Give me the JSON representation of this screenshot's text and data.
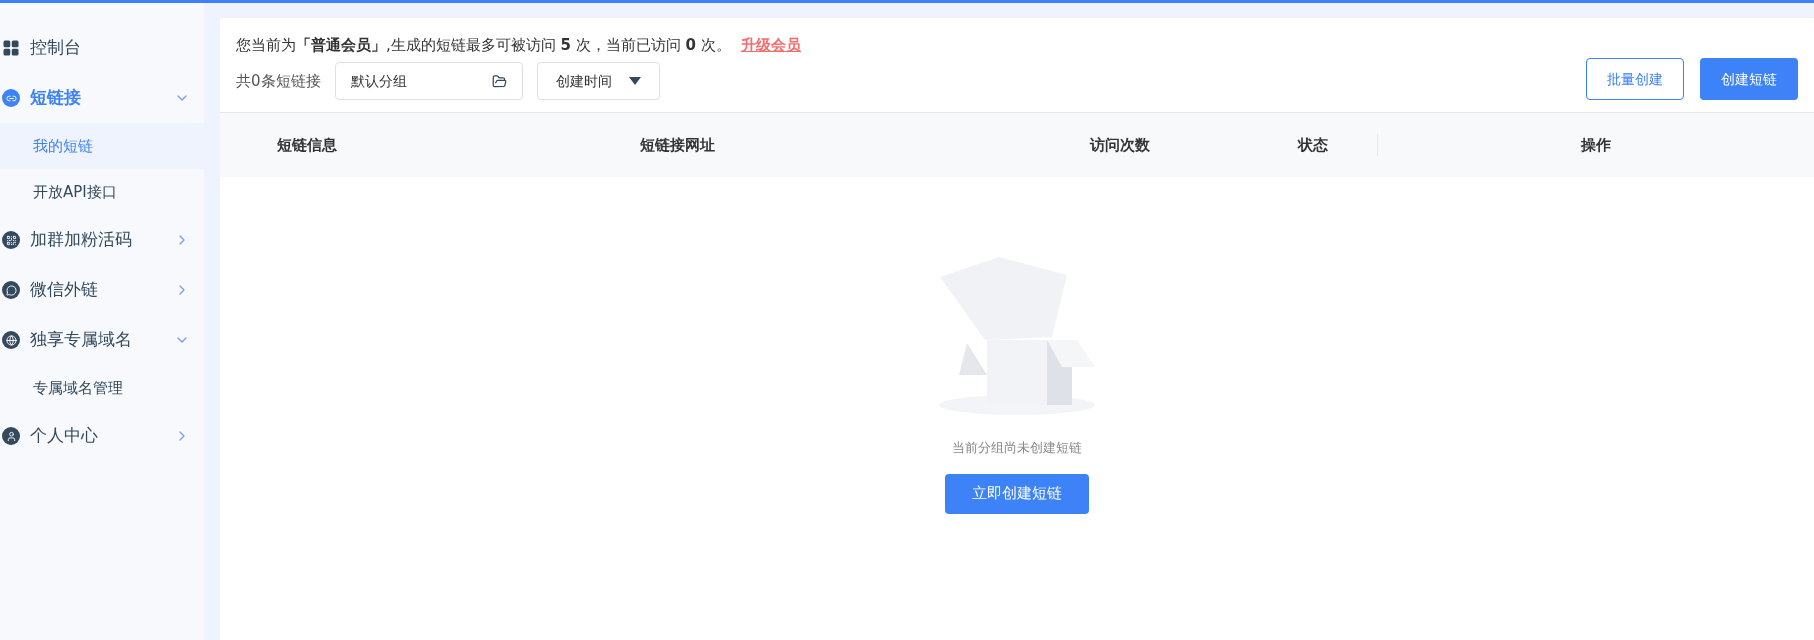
{
  "sidebar": {
    "items": [
      {
        "label": "控制台",
        "kind": "link",
        "selected": false
      },
      {
        "label": "短链接",
        "kind": "group",
        "selected": true,
        "expanded": true,
        "children": [
          {
            "label": "我的短链",
            "selected": true
          },
          {
            "label": "开放API接口",
            "selected": false
          }
        ]
      },
      {
        "label": "加群加粉活码",
        "kind": "group",
        "selected": false,
        "expanded": false
      },
      {
        "label": "微信外链",
        "kind": "group",
        "selected": false,
        "expanded": false
      },
      {
        "label": "独享专属域名",
        "kind": "group",
        "selected": false,
        "expanded": true,
        "children": [
          {
            "label": "专属域名管理",
            "selected": false
          }
        ]
      },
      {
        "label": "个人中心",
        "kind": "group",
        "selected": false,
        "expanded": false
      }
    ]
  },
  "notice": {
    "text": "您当前为**「普通会员」**,生成的短链最多可被访问 **5** 次，当前已访问 **0** 次。",
    "link": "升级会员"
  },
  "toolbar": {
    "count": "共0条短链接",
    "group_select": {
      "value": "默认分组"
    },
    "sort_select": {
      "value": "创建时间"
    },
    "buttons": [
      {
        "label": "批量创建",
        "kind": "outline"
      },
      {
        "label": "创建短链",
        "kind": "primary"
      }
    ]
  },
  "table": {
    "columns": [
      "短链信息",
      "短链接网址",
      "访问次数",
      "状态",
      "操作"
    ]
  },
  "empty_state": {
    "message": "当前分组尚未创建短链",
    "button": "立即创建短链"
  }
}
